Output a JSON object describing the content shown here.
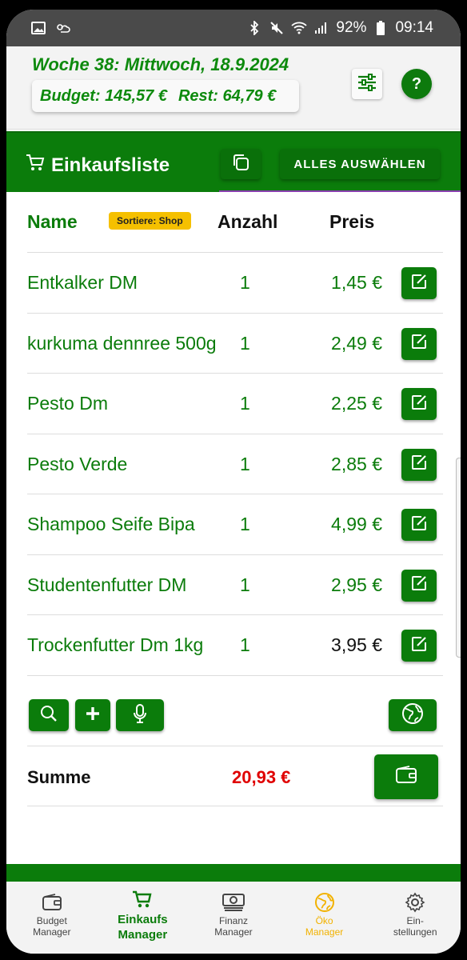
{
  "status_bar": {
    "battery": "92%",
    "time": "09:14"
  },
  "header": {
    "date_title": "Woche 38: Mittwoch, 18.9.2024",
    "budget": "Budget: 145,57 €",
    "rest": "Rest: 64,79 €",
    "help_label": "?"
  },
  "toolbar": {
    "title": "Einkaufsliste",
    "select_all_label": "ALLES AUSWÄHLEN"
  },
  "table": {
    "col_name": "Name",
    "sort_badge": "Sortiere: Shop",
    "col_qty": "Anzahl",
    "col_price": "Preis",
    "rows": [
      {
        "name": "Entkalker DM",
        "qty": "1",
        "price": "1,45 €"
      },
      {
        "name": "kurkuma dennree 500g",
        "qty": "1",
        "price": "2,49 €"
      },
      {
        "name": "Pesto Dm",
        "qty": "1",
        "price": "2,25 €"
      },
      {
        "name": "Pesto Verde",
        "qty": "1",
        "price": "2,85 €"
      },
      {
        "name": "Shampoo Seife Bipa",
        "qty": "1",
        "price": "4,99 €"
      },
      {
        "name": "Studentenfutter DM",
        "qty": "1",
        "price": "2,95 €"
      },
      {
        "name": "Trockenfutter Dm 1kg",
        "qty": "1",
        "price": "3,95 €"
      }
    ]
  },
  "summary": {
    "label": "Summe",
    "total": "20,93 €"
  },
  "bottom_nav": [
    {
      "label": "Budget\nManager",
      "icon": "wallet-icon"
    },
    {
      "label": "Einkaufs\nManager",
      "icon": "cart-icon"
    },
    {
      "label": "Finanz\nManager",
      "icon": "money-icon"
    },
    {
      "label": "Öko\nManager",
      "icon": "globe-icon"
    },
    {
      "label": "Ein-\nstellungen",
      "icon": "gear-icon"
    }
  ],
  "colors": {
    "primary_green": "#0b7c0b",
    "accent_yellow": "#f2b200",
    "total_red": "#e00000"
  }
}
